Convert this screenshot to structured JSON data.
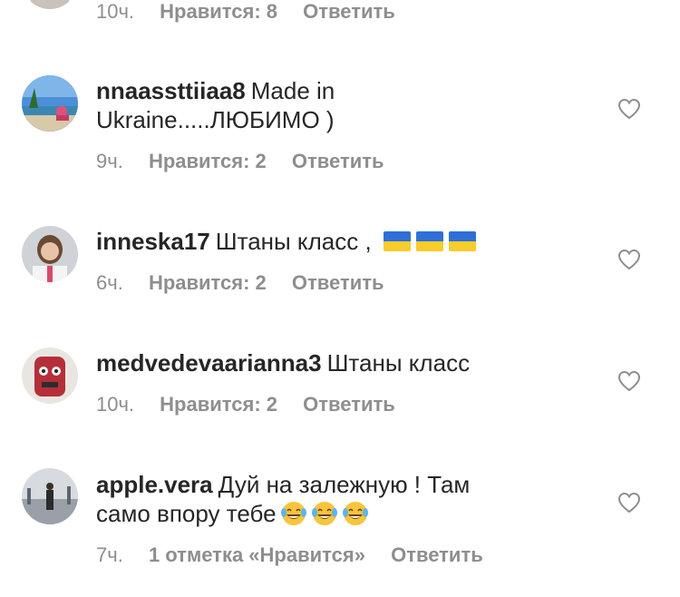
{
  "top_partial": {
    "time": "10ч.",
    "likes": "Нравится: 8",
    "reply": "Ответить"
  },
  "comments": [
    {
      "username": "nnaassttiiaa8",
      "text_line1": "Made in",
      "text_line2": "Ukraine.....ЛЮБИМО )",
      "time": "9ч.",
      "likes": "Нравится: 2",
      "reply": "Ответить"
    },
    {
      "username": "inneska17",
      "text": "Штаны класс ,",
      "emoji": [
        "ukraine-flag",
        "ukraine-flag",
        "ukraine-flag"
      ],
      "time": "6ч.",
      "likes": "Нравится: 2",
      "reply": "Ответить"
    },
    {
      "username": "medvedevaarianna3",
      "text": "Штаны класс",
      "time": "10ч.",
      "likes": "Нравится: 2",
      "reply": "Ответить"
    },
    {
      "username": "apple.vera",
      "text_line1": "Дуй на залежную ! Там",
      "text_line2": "само впору тебе",
      "emoji": [
        "tears-of-joy",
        "tears-of-joy",
        "tears-of-joy"
      ],
      "time": "7ч.",
      "likes": "1 отметка «Нравится»",
      "reply": "Ответить"
    }
  ],
  "colors": {
    "text": "#262626",
    "meta": "#8e8e8e",
    "heart_outline": "#8e8e8e"
  }
}
